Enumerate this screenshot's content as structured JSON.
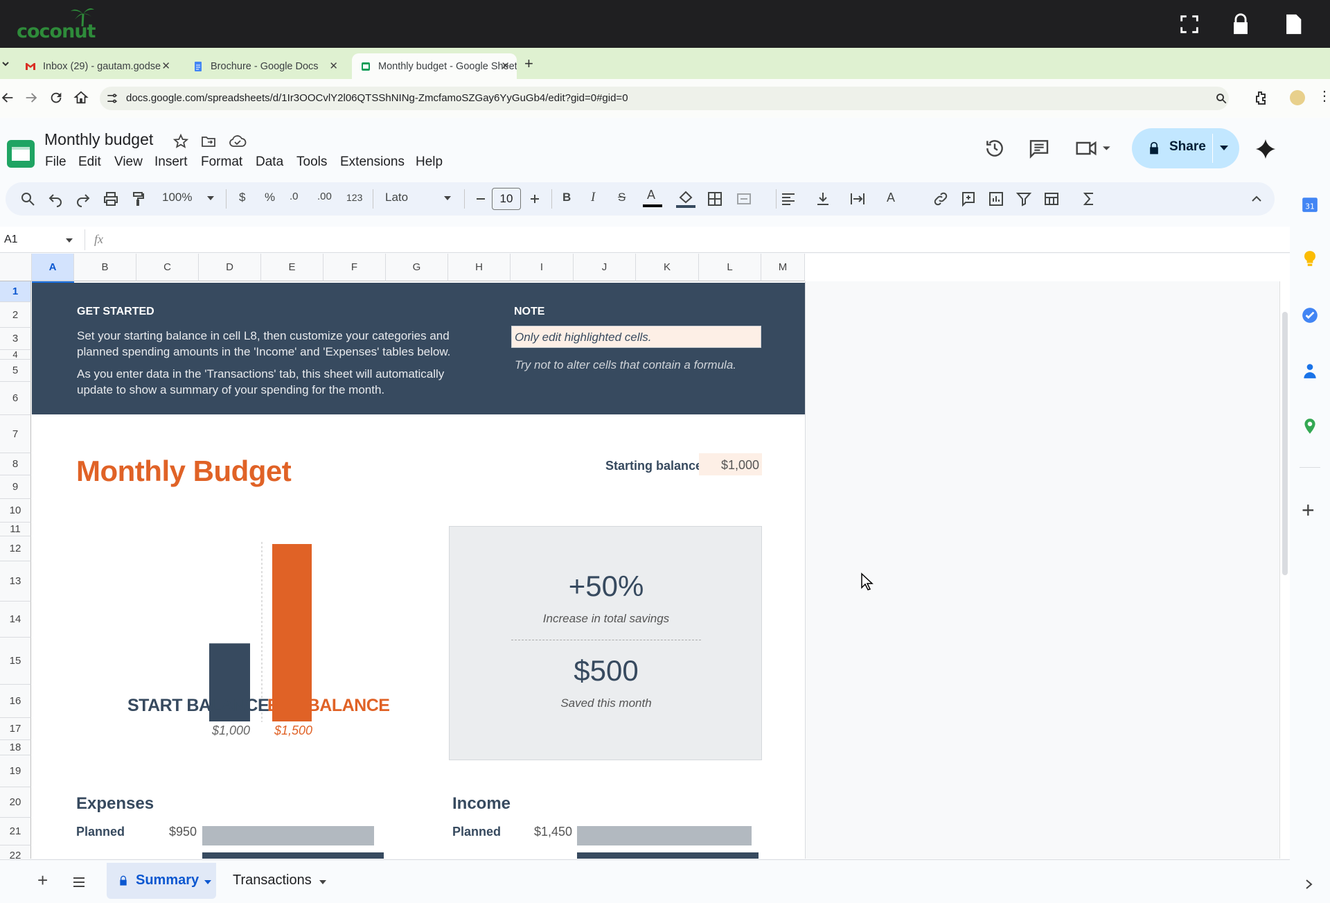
{
  "topbar": {
    "logo_text": "coconut"
  },
  "tabs": [
    {
      "label": "Inbox (29) - gautam.godse",
      "fav": "gmail"
    },
    {
      "label": "Brochure - Google Docs",
      "fav": "docs"
    },
    {
      "label": "Monthly budget - Google Sheets",
      "fav": "sheets"
    }
  ],
  "address": {
    "url": "docs.google.com/spreadsheets/d/1Ir3OOCvlY2l06QTSShNINg-ZmcfamoSZGay6YyGuGb4/edit?gid=0#gid=0"
  },
  "doc": {
    "title": "Monthly budget"
  },
  "menu": [
    "File",
    "Edit",
    "View",
    "Insert",
    "Format",
    "Data",
    "Tools",
    "Extensions",
    "Help"
  ],
  "share": {
    "label": "Share"
  },
  "toolbar": {
    "zoom": "100%",
    "currency": "$",
    "percent": "%",
    "dec_minus": ".0",
    "dec_plus": ".00",
    "number_format": "123",
    "font": "Lato",
    "font_size": "10"
  },
  "formula": {
    "cell_ref": "A1",
    "fx": "fx"
  },
  "columns": [
    "A",
    "B",
    "C",
    "D",
    "E",
    "F",
    "G",
    "H",
    "I",
    "J",
    "K",
    "L",
    "M"
  ],
  "rows": [
    "1",
    "2",
    "3",
    "4",
    "5",
    "6",
    "7",
    "8",
    "9",
    "10",
    "11",
    "12",
    "13",
    "14",
    "15",
    "16",
    "17",
    "18",
    "19",
    "20",
    "21",
    "22"
  ],
  "banner": {
    "get_started": "GET STARTED",
    "text1": "Set your starting balance in cell L8, then customize your categories and planned spending amounts in the 'Income' and 'Expenses' tables below.",
    "text2": "As you enter data in the 'Transactions' tab, this sheet will automatically update to show a summary of your spending for the month.",
    "note": "NOTE",
    "note1": "Only edit highlighted cells.",
    "note2": "Try not to alter cells that contain a formula."
  },
  "budget": {
    "title": "Monthly Budget",
    "starting_label": "Starting balance:",
    "starting_value": "$1,000",
    "start_label": "START BALANCE",
    "start_value": "$1,000",
    "end_label": "END BALANCE",
    "end_value": "$1,500",
    "pct": "+50%",
    "pct_caption": "Increase in total savings",
    "saved": "$500",
    "saved_caption": "Saved this month",
    "expenses": "Expenses",
    "income": "Income",
    "exp_planned_label": "Planned",
    "exp_planned_value": "$950",
    "inc_planned_label": "Planned",
    "inc_planned_value": "$1,450"
  },
  "chart_data": {
    "type": "bar",
    "categories": [
      "START BALANCE",
      "END BALANCE"
    ],
    "values": [
      1000,
      1500
    ],
    "colors": [
      "#374a5f",
      "#e06226"
    ]
  },
  "sheets": [
    {
      "label": "Summary"
    },
    {
      "label": "Transactions"
    }
  ],
  "colors": {
    "banner": "#374a5f",
    "accent": "#e06226",
    "highlight": "#fdefe6",
    "panel": "#ebedef"
  }
}
